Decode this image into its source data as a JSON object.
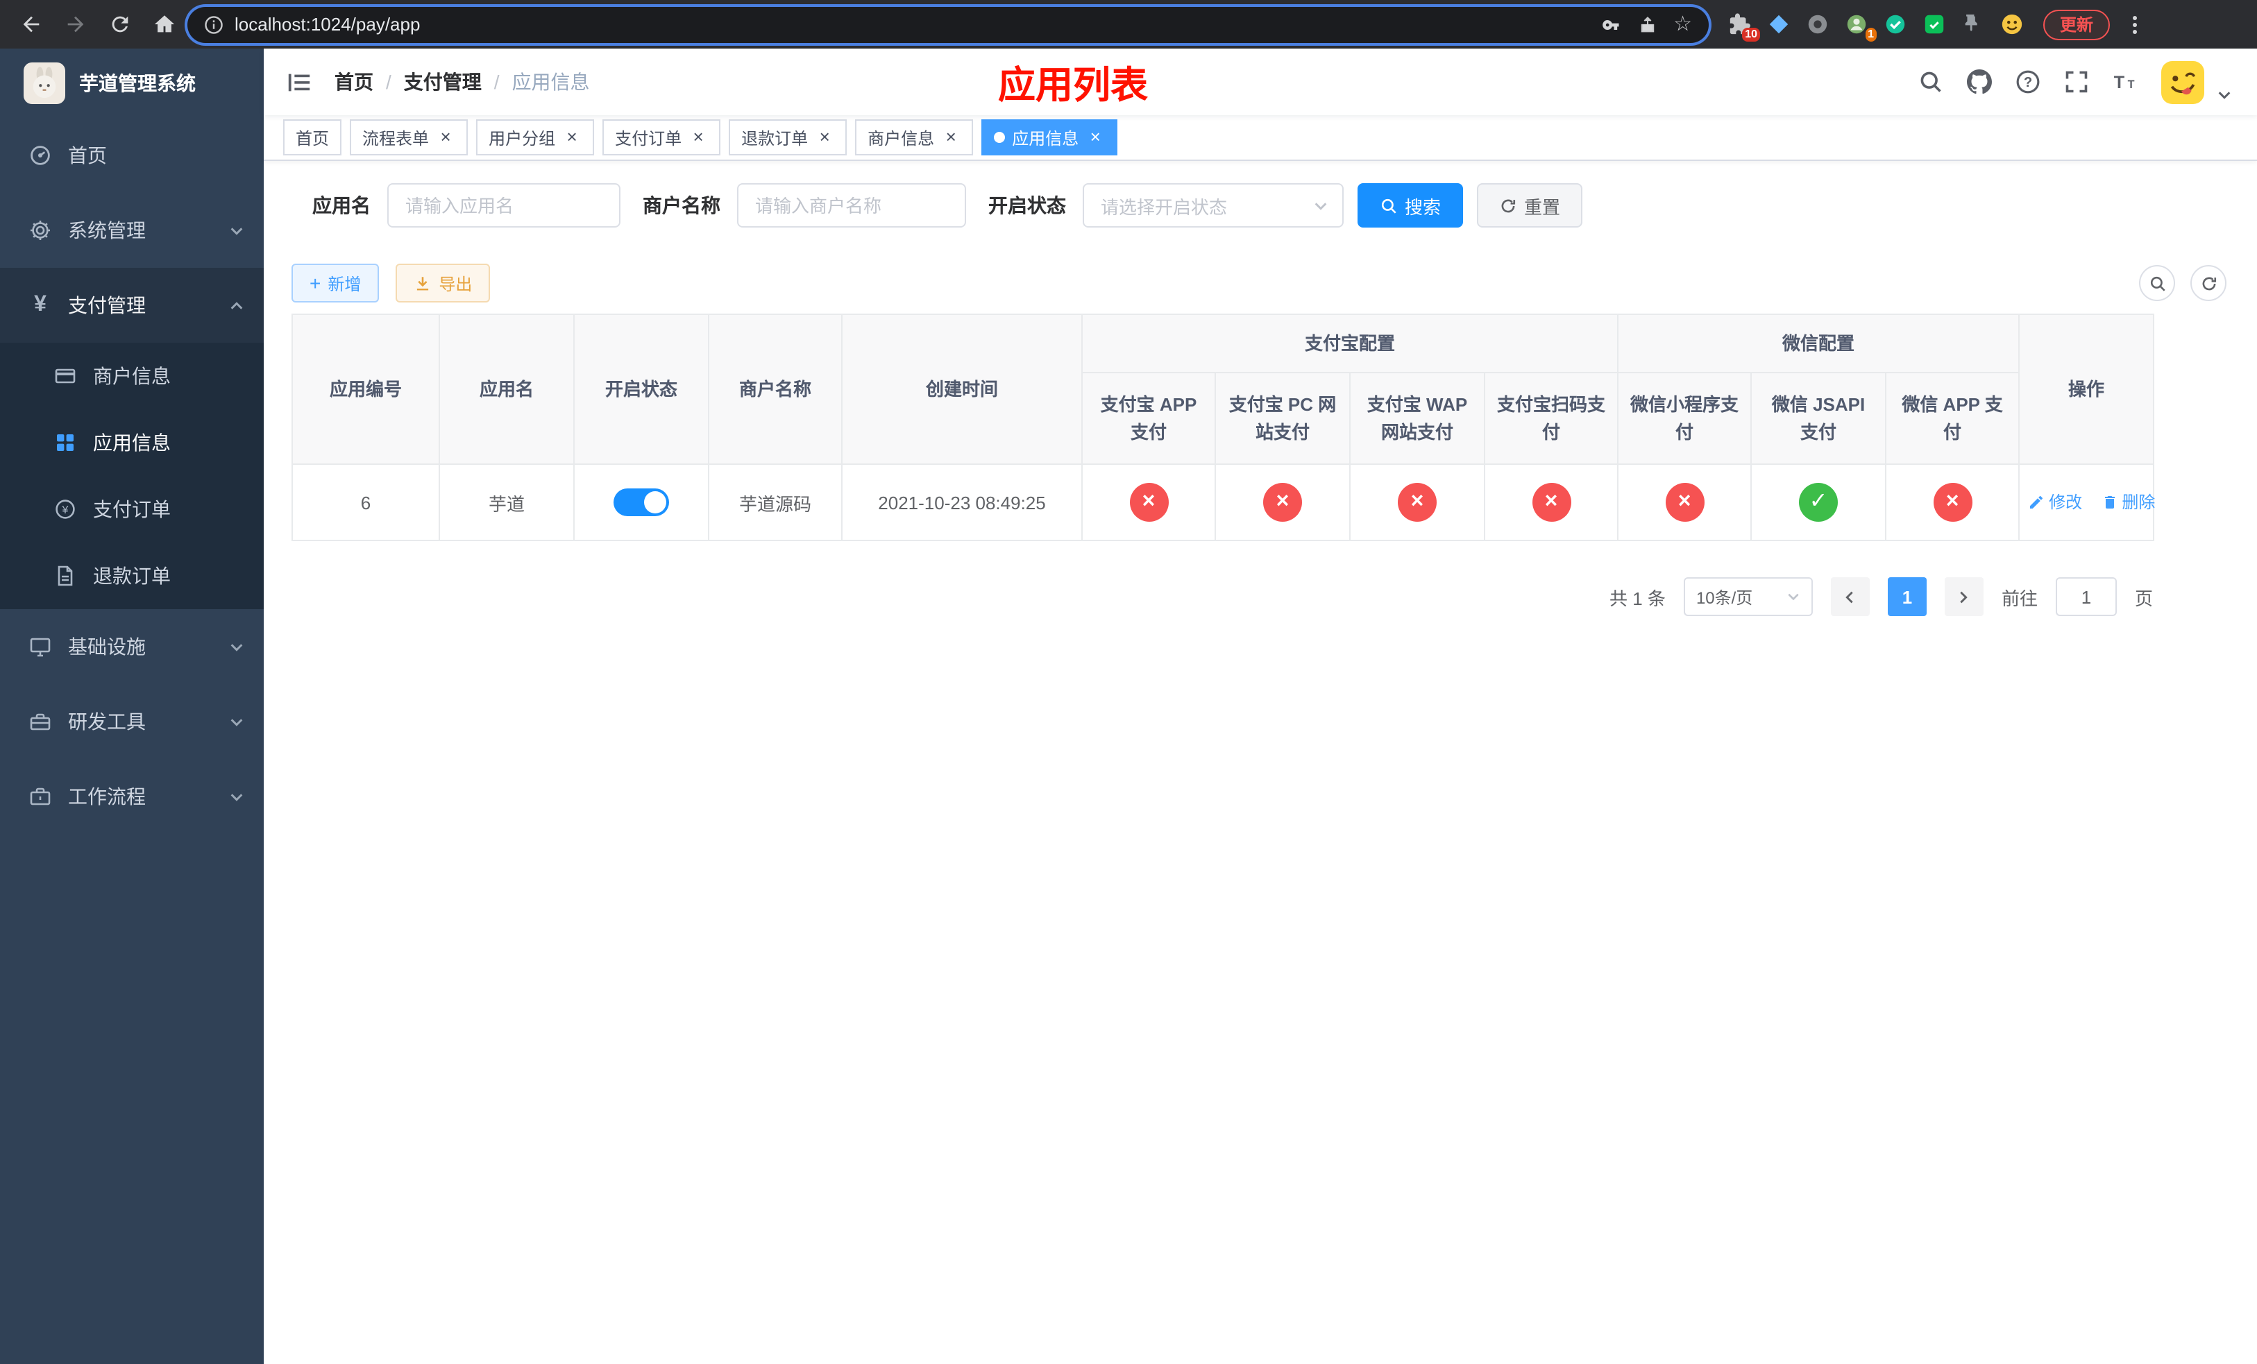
{
  "browser": {
    "url": "localhost:1024/pay/app",
    "update_button": "更新",
    "extensions_badge": "10",
    "avatar_badge": "1"
  },
  "icons": {
    "star": "☆",
    "close": "×",
    "plus": "+",
    "yen": "¥",
    "check": "✓",
    "cross": "×",
    "breadcrumb_separator": "/"
  },
  "sidebar": {
    "app_title": "芋道管理系统",
    "menu": [
      {
        "label": "首页",
        "icon": "dashboard-icon"
      },
      {
        "label": "系统管理",
        "icon": "gear-icon"
      },
      {
        "label": "支付管理",
        "icon": "yen-icon"
      },
      {
        "label": "基础设施",
        "icon": "monitor-icon"
      },
      {
        "label": "研发工具",
        "icon": "toolbox-icon"
      },
      {
        "label": "工作流程",
        "icon": "briefcase-icon"
      }
    ],
    "payment_submenu": [
      {
        "label": "商户信息",
        "icon": "credit-card-icon"
      },
      {
        "label": "应用信息",
        "icon": "grid-icon",
        "active": true
      },
      {
        "label": "支付订单",
        "icon": "pay-order-icon"
      },
      {
        "label": "退款订单",
        "icon": "refund-doc-icon"
      }
    ]
  },
  "header": {
    "breadcrumb": [
      "首页",
      "支付管理",
      "应用信息"
    ],
    "page_title": "应用列表"
  },
  "tabs": [
    {
      "label": "首页",
      "closable": false
    },
    {
      "label": "流程表单",
      "closable": true
    },
    {
      "label": "用户分组",
      "closable": true
    },
    {
      "label": "支付订单",
      "closable": true
    },
    {
      "label": "退款订单",
      "closable": true
    },
    {
      "label": "商户信息",
      "closable": true
    },
    {
      "label": "应用信息",
      "closable": true,
      "active": true
    }
  ],
  "filters": {
    "app_name_label": "应用名",
    "app_name_placeholder": "请输入应用名",
    "merchant_label": "商户名称",
    "merchant_placeholder": "请输入商户名称",
    "status_label": "开启状态",
    "status_placeholder": "请选择开启状态",
    "search_button": "搜索",
    "reset_button": "重置"
  },
  "toolbar": {
    "add_button": "新增",
    "export_button": "导出"
  },
  "table": {
    "headers": {
      "app_id": "应用编号",
      "app_name": "应用名",
      "status": "开启状态",
      "merchant": "商户名称",
      "created": "创建时间",
      "alipay_group": "支付宝配置",
      "wechat_group": "微信配置",
      "alipay_app": "支付宝 APP 支付",
      "alipay_pc": "支付宝 PC 网站支付",
      "alipay_wap": "支付宝 WAP 网站支付",
      "alipay_qr": "支付宝扫码支付",
      "wechat_lite": "微信小程序支付",
      "wechat_jsapi": "微信 JSAPI 支付",
      "wechat_app": "微信 APP 支付",
      "actions": "操作"
    },
    "row": {
      "app_id": "6",
      "app_name": "芋道",
      "status_on": true,
      "merchant": "芋道源码",
      "created": "2021-10-23 08:49:25",
      "configs": [
        "no",
        "no",
        "no",
        "no",
        "no",
        "yes",
        "no"
      ],
      "edit_label": "修改",
      "delete_label": "删除"
    }
  },
  "pagination": {
    "total": "共 1 条",
    "page_size": "10条/页",
    "page": "1",
    "goto_prefix": "前往",
    "goto_value": "1",
    "goto_suffix": "页"
  },
  "colors": {
    "accent_blue": "#409eff",
    "primary_blue": "#1890ff",
    "title_red": "#ff1200",
    "success_green": "#3dbd49",
    "danger_red": "#f65252",
    "warning_orange": "#e6a23c",
    "sidebar_bg": "#304156",
    "submenu_bg": "#1f2d3d"
  }
}
